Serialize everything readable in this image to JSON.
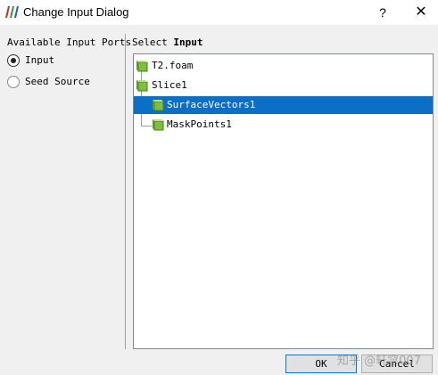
{
  "window": {
    "title": "Change Input Dialog",
    "help_symbol": "?",
    "close_symbol": "✕"
  },
  "left_panel": {
    "label": "Available Input Ports",
    "ports": [
      {
        "label": "Input",
        "selected": true
      },
      {
        "label": "Seed Source",
        "selected": false
      }
    ]
  },
  "right_panel": {
    "label_prefix": "Select",
    "label_bold": "Input",
    "tree": [
      {
        "label": "T2.foam",
        "selected": false
      },
      {
        "label": "Slice1",
        "selected": false
      },
      {
        "label": "SurfaceVectors1",
        "selected": true
      },
      {
        "label": "MaskPoints1",
        "selected": false
      }
    ]
  },
  "buttons": {
    "ok": "OK",
    "cancel": "Cancel"
  },
  "watermark": "知乎 @轩穹007",
  "colors": {
    "selection": "#0b6ec7",
    "cube": "#8cc84b"
  }
}
